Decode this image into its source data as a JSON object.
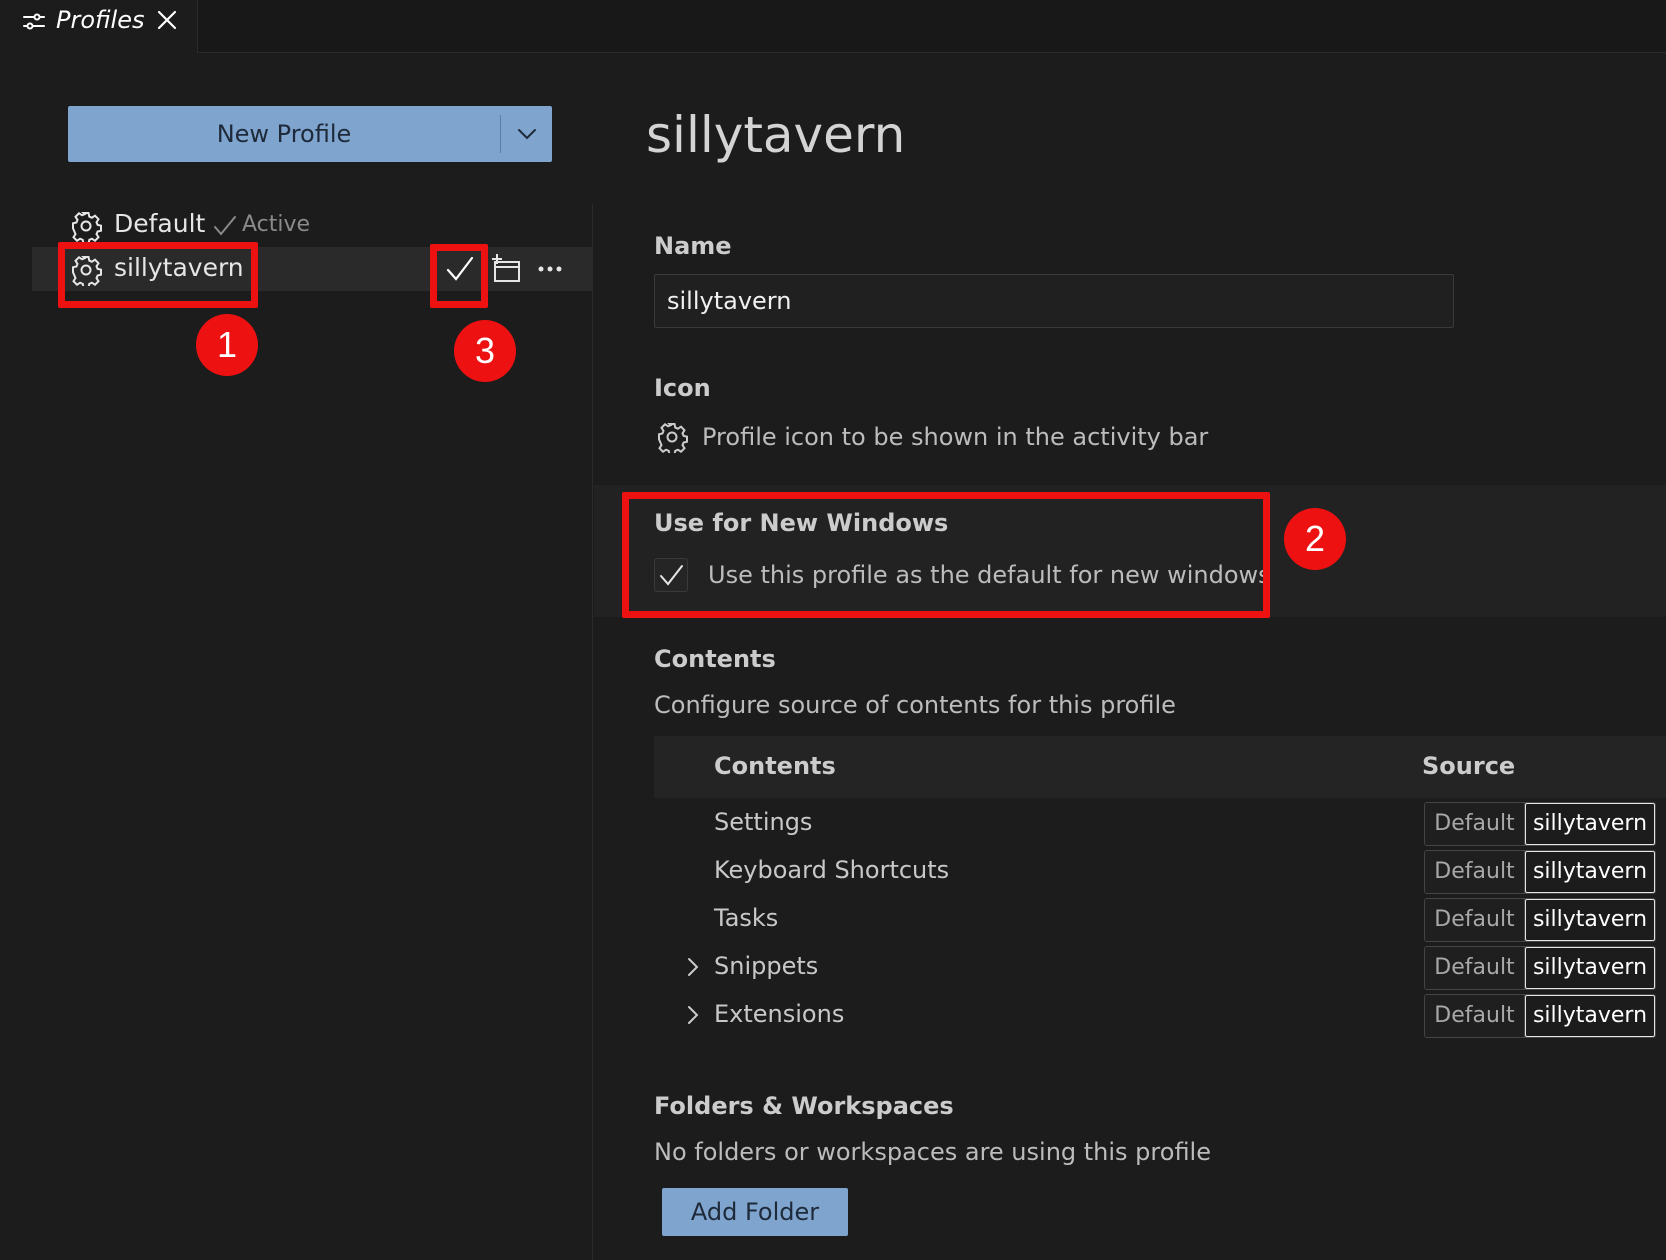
{
  "tab": {
    "title": "Profiles",
    "icon": "settings-sliders-icon",
    "close_icon": "close-icon"
  },
  "sidebar": {
    "new_profile_label": "New Profile",
    "profiles": [
      {
        "name": "Default",
        "status": "Active",
        "icon": "gear-icon"
      },
      {
        "name": "sillytavern",
        "icon": "gear-icon",
        "selected": true
      }
    ]
  },
  "main": {
    "title": "sillytavern",
    "name_label": "Name",
    "name_value": "sillytavern",
    "icon_label": "Icon",
    "icon_desc": "Profile icon to be shown in the activity bar",
    "new_windows_label": "Use for New Windows",
    "new_windows_desc": "Use this profile as the default for new windows",
    "new_windows_checked": true,
    "contents_label": "Contents",
    "contents_desc": "Configure source of contents for this profile",
    "table": {
      "headers": [
        "Contents",
        "Source"
      ],
      "rows": [
        {
          "label": "Settings",
          "expandable": false,
          "options": [
            "Default",
            "sillytavern"
          ],
          "selected": "sillytavern"
        },
        {
          "label": "Keyboard Shortcuts",
          "expandable": false,
          "options": [
            "Default",
            "sillytavern"
          ],
          "selected": "sillytavern"
        },
        {
          "label": "Tasks",
          "expandable": false,
          "options": [
            "Default",
            "sillytavern"
          ],
          "selected": "sillytavern"
        },
        {
          "label": "Snippets",
          "expandable": true,
          "options": [
            "Default",
            "sillytavern"
          ],
          "selected": "sillytavern"
        },
        {
          "label": "Extensions",
          "expandable": true,
          "options": [
            "Default",
            "sillytavern"
          ],
          "selected": "sillytavern"
        }
      ]
    },
    "folders_label": "Folders & Workspaces",
    "folders_desc": "No folders or workspaces are using this profile",
    "add_folder_label": "Add Folder"
  },
  "annotations": {
    "markers": [
      "1",
      "2",
      "3"
    ],
    "color": "#ee1111"
  },
  "colors": {
    "accent_button": "#7fa5cf",
    "background": "#1c1c1c"
  }
}
